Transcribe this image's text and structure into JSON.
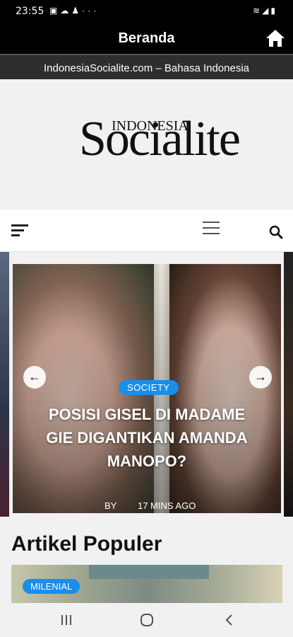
{
  "status": {
    "time": "23:55",
    "left_icons": [
      "image-icon",
      "cloud-icon",
      "notification-icon",
      "more-icon"
    ],
    "right_icons": [
      "wifi-icon",
      "signal-icon",
      "battery-icon"
    ]
  },
  "app_bar": {
    "title": "Beranda",
    "home_icon": "home-icon"
  },
  "url_bar": {
    "text": "IndonesiaSocialite.com – Bahasa Indonesia"
  },
  "logo": {
    "top": "INDONESIA",
    "main": "Socialite"
  },
  "nav": {
    "left_icon": "hamburger-menu-icon",
    "mid_icon": "menu-icon",
    "right_icon": "search-icon"
  },
  "carousel": {
    "slides": [
      {
        "category": "SOCIETY",
        "headline": "POSISI GISEL DI MADAME GIE DIGANTIKAN AMANDA MANOPO?",
        "by": "BY",
        "time_ago": "17 MINS AGO"
      }
    ],
    "prev_icon": "arrow-left-icon",
    "next_icon": "arrow-right-icon"
  },
  "popular": {
    "title": "Artikel Populer",
    "first_category": "MILENIAL"
  },
  "system_nav": {
    "recents": "recents-icon",
    "home": "home-circle-icon",
    "back": "back-icon"
  },
  "colors": {
    "badge": "#1a8ee8",
    "bar": "#000000",
    "url_bar": "#2e2e2e"
  }
}
